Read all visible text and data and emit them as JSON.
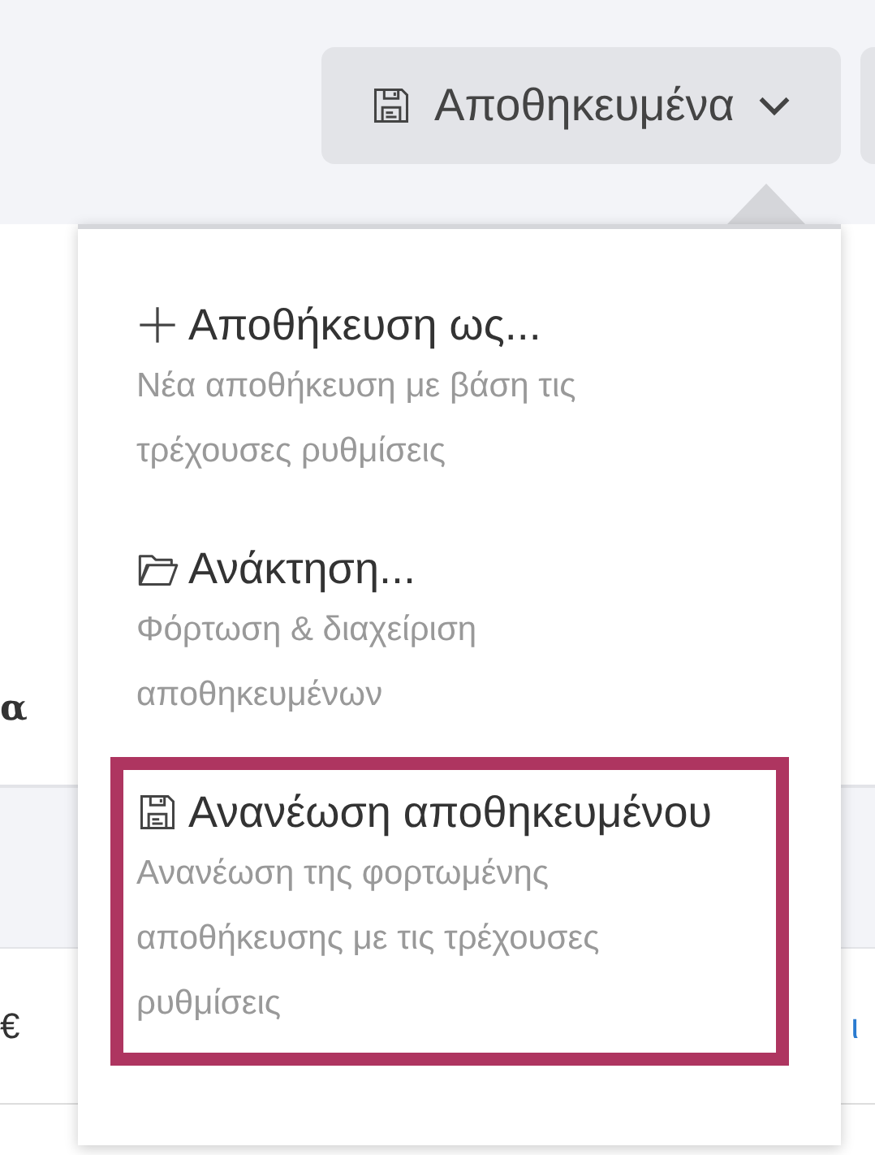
{
  "toolbar": {
    "saved_button": {
      "label": "Αποθηκευμένα",
      "expanded": true
    }
  },
  "table": {
    "heading_fragment": "α",
    "rows": [
      {
        "kind": "band"
      },
      {
        "kind": "plain",
        "left": "€",
        "right": "ι"
      }
    ]
  },
  "menu": {
    "items": [
      {
        "kind": "plus",
        "title": "Αποθήκευση ως...",
        "description": "Νέα αποθήκευση με βάση τις τρέχουσες ρυθμίσεις",
        "selected": false
      },
      {
        "kind": "folder",
        "title": "Ανάκτηση...",
        "description": "Φόρτωση & διαχείριση αποθηκευμένων",
        "selected": false
      },
      {
        "kind": "floppy",
        "title": "Ανανέωση αποθηκευμένου",
        "description": "Ανανέωση της φορτωμένης αποθήκευσης με τις τρέχουσες ρυθμίσεις",
        "selected": true
      }
    ]
  }
}
